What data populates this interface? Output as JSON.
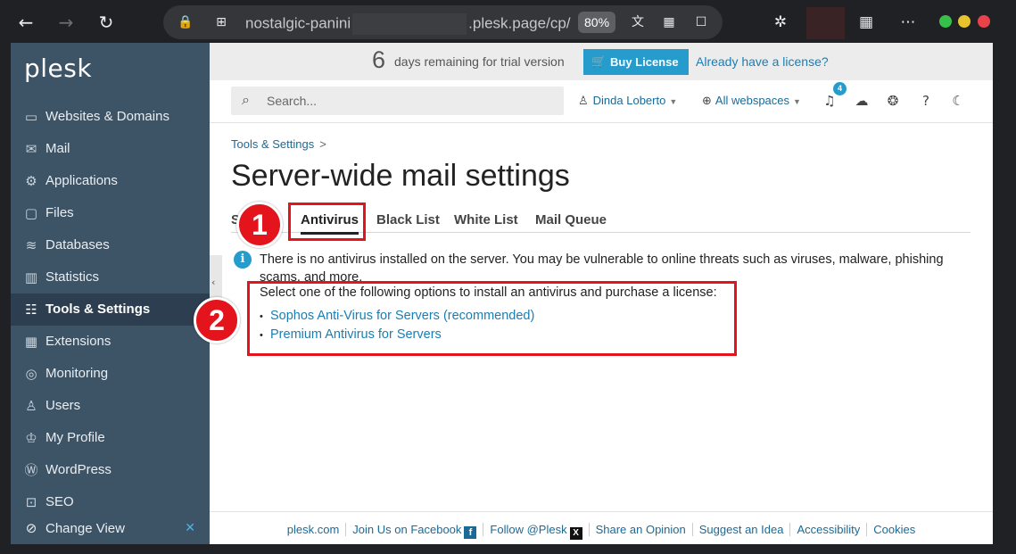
{
  "browser": {
    "url_prefix": "nostalgic-panini",
    "url_suffix": ".plesk.page/cp/",
    "zoom": "80%"
  },
  "sidebar": {
    "logo": "plesk",
    "items": [
      {
        "label": "Websites & Domains",
        "icon": "monitor-icon"
      },
      {
        "label": "Mail",
        "icon": "mail-icon"
      },
      {
        "label": "Applications",
        "icon": "gear-icon"
      },
      {
        "label": "Files",
        "icon": "folder-icon"
      },
      {
        "label": "Databases",
        "icon": "database-icon"
      },
      {
        "label": "Statistics",
        "icon": "bar-chart-icon"
      },
      {
        "label": "Tools & Settings",
        "icon": "sliders-icon",
        "active": true
      },
      {
        "label": "Extensions",
        "icon": "grid-icon"
      },
      {
        "label": "Monitoring",
        "icon": "monitoring-icon"
      },
      {
        "label": "Users",
        "icon": "user-icon"
      },
      {
        "label": "My Profile",
        "icon": "profile-icon"
      },
      {
        "label": "WordPress",
        "icon": "wordpress-icon"
      },
      {
        "label": "SEO",
        "icon": "seo-icon"
      }
    ],
    "change_view": "Change View"
  },
  "trial": {
    "days": "6",
    "text": "days remaining for trial version",
    "buy_label": "Buy License",
    "already_label": "Already have a license?"
  },
  "topbar": {
    "search_placeholder": "Search...",
    "user_name": "Dinda Loberto",
    "webspaces": "All webspaces",
    "notifications_count": "4"
  },
  "breadcrumb": {
    "item": "Tools & Settings",
    "sep": ">"
  },
  "page_title": "Server-wide mail settings",
  "tabs": [
    {
      "label": "S",
      "active": false
    },
    {
      "label": "Antivirus",
      "active": true
    },
    {
      "label": "Black List",
      "active": false
    },
    {
      "label": "White List",
      "active": false
    },
    {
      "label": "Mail Queue",
      "active": false
    }
  ],
  "content": {
    "info_icon_glyph": "i",
    "warning": "There is no antivirus installed on the server. You may be vulnerable to online threats such as viruses, malware, phishing scams, and more.",
    "select_prompt": "Select one of the following options to install an antivirus and purchase a license:",
    "options": [
      "Sophos Anti-Virus for Servers (recommended)",
      "Premium Antivirus for Servers"
    ]
  },
  "footer": {
    "links": [
      "plesk.com",
      "Join Us on Facebook",
      "Follow @Plesk",
      "Share an Opinion",
      "Suggest an Idea",
      "Accessibility",
      "Cookies"
    ],
    "facebook_glyph": "f",
    "x_glyph": "X"
  },
  "annotations": {
    "badge_1": "1",
    "badge_2": "2",
    "color": "#e3141b"
  },
  "colors": {
    "sidebar": "#3d5366",
    "sidebar_active": "#2c3e50",
    "accent": "#259ccc",
    "link": "#1a7eb3"
  }
}
